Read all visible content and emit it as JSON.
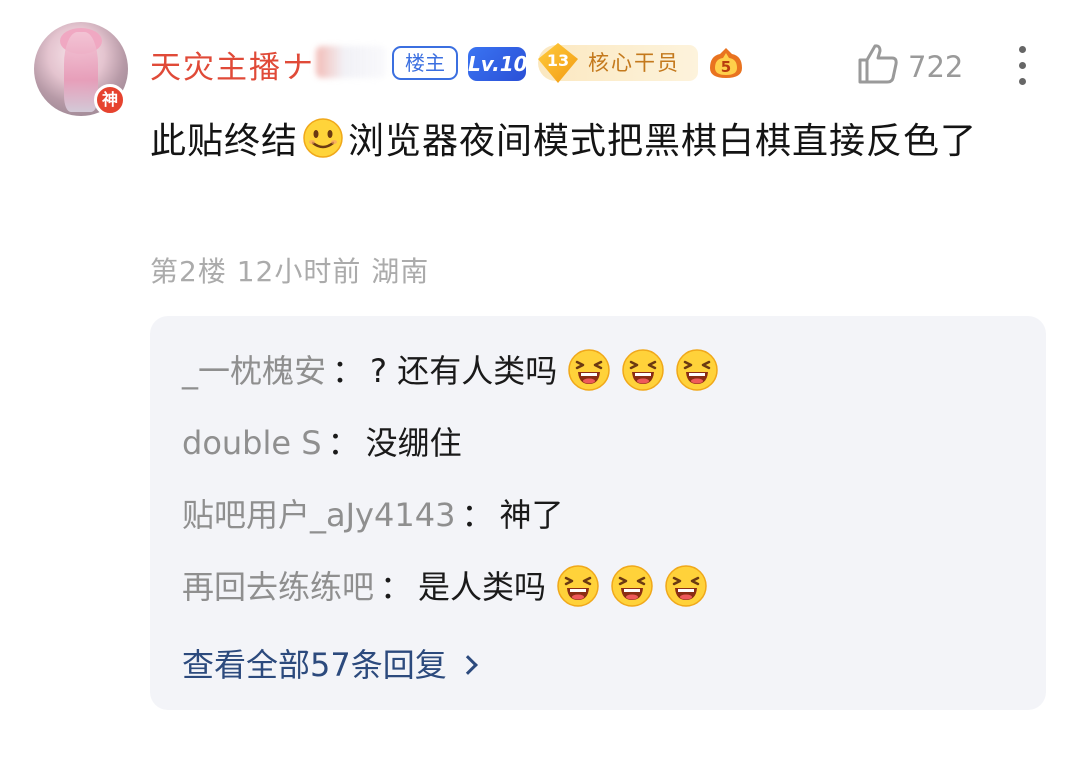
{
  "post": {
    "author": {
      "name": "天灾主播ナ",
      "god_badge": "神",
      "tags": {
        "louzhu": "楼主",
        "level": "Lv.10",
        "core_level": "13",
        "core_label": "核心干员",
        "fire_badge": "5"
      }
    },
    "like_count": "722",
    "text_before_emoji": "此贴终结",
    "text_after_emoji": "浏览器夜间模式把黑棋白棋直接反色了",
    "meta": "第2楼 12小时前 湖南"
  },
  "replies": [
    {
      "user": "_一枕槐安",
      "separator": "：",
      "text": "? 还有人类吗",
      "emoji_count": 3
    },
    {
      "user": "double S",
      "separator": "：",
      "text": "没绷住",
      "emoji_count": 0
    },
    {
      "user": "贴吧用户_aJy4143",
      "separator": "：",
      "text": "神了",
      "emoji_count": 0
    },
    {
      "user": "再回去练练吧",
      "separator": "：",
      "text": "是人类吗",
      "emoji_count": 3
    }
  ],
  "view_all": "查看全部57条回复",
  "icons": {
    "like": "thumb-up-icon",
    "more": "more-vertical-icon",
    "smile": "smile-emoji-icon",
    "laugh": "laugh-emoji-icon",
    "chevron": "chevron-right-icon"
  },
  "colors": {
    "username": "#e04a38",
    "reply_user": "#8f8f8f",
    "link": "#2c4a7d",
    "meta": "#ababab",
    "reply_bg": "#f3f4f8"
  }
}
